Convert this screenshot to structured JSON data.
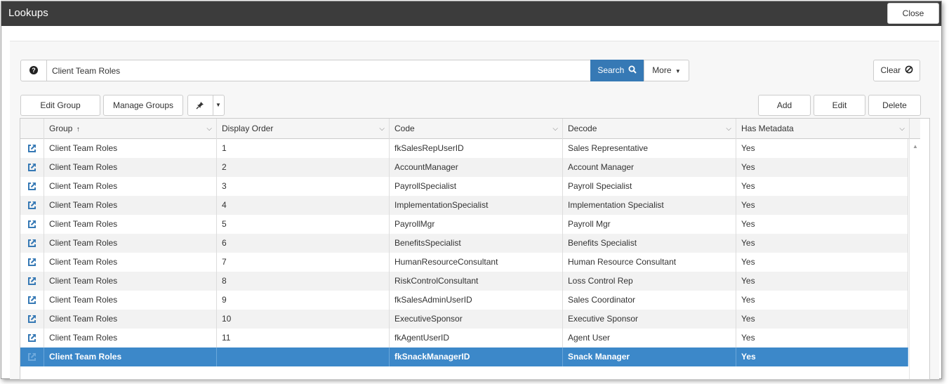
{
  "window": {
    "title": "Lookups",
    "close_label": "Close"
  },
  "search": {
    "help_symbol": "?",
    "value": "Client Team Roles",
    "search_label": "Search",
    "more_label": "More",
    "clear_label": "Clear"
  },
  "toolbar": {
    "edit_group": "Edit Group",
    "manage_groups": "Manage Groups",
    "add": "Add",
    "edit": "Edit",
    "delete": "Delete"
  },
  "grid": {
    "columns": [
      "Group",
      "Display Order",
      "Code",
      "Decode",
      "Has Metadata"
    ],
    "sort_indicator": "↑",
    "rows": [
      {
        "group": "Client Team Roles",
        "order": "1",
        "code": "fkSalesRepUserID",
        "decode": "Sales Representative",
        "meta": "Yes"
      },
      {
        "group": "Client Team Roles",
        "order": "2",
        "code": "AccountManager",
        "decode": "Account Manager",
        "meta": "Yes"
      },
      {
        "group": "Client Team Roles",
        "order": "3",
        "code": "PayrollSpecialist",
        "decode": "Payroll Specialist",
        "meta": "Yes"
      },
      {
        "group": "Client Team Roles",
        "order": "4",
        "code": "ImplementationSpecialist",
        "decode": "Implementation Specialist",
        "meta": "Yes"
      },
      {
        "group": "Client Team Roles",
        "order": "5",
        "code": "PayrollMgr",
        "decode": "Payroll Mgr",
        "meta": "Yes"
      },
      {
        "group": "Client Team Roles",
        "order": "6",
        "code": "BenefitsSpecialist",
        "decode": "Benefits Specialist",
        "meta": "Yes"
      },
      {
        "group": "Client Team Roles",
        "order": "7",
        "code": "HumanResourceConsultant",
        "decode": "Human Resource Consultant",
        "meta": "Yes"
      },
      {
        "group": "Client Team Roles",
        "order": "8",
        "code": "RiskControlConsultant",
        "decode": "Loss Control Rep",
        "meta": "Yes"
      },
      {
        "group": "Client Team Roles",
        "order": "9",
        "code": "fkSalesAdminUserID",
        "decode": "Sales Coordinator",
        "meta": "Yes"
      },
      {
        "group": "Client Team Roles",
        "order": "10",
        "code": "ExecutiveSponsor",
        "decode": "Executive Sponsor",
        "meta": "Yes"
      },
      {
        "group": "Client Team Roles",
        "order": "11",
        "code": "fkAgentUserID",
        "decode": "Agent User",
        "meta": "Yes"
      },
      {
        "group": "Client Team Roles",
        "order": "",
        "code": "fkSnackManagerID",
        "decode": "Snack Manager",
        "meta": "Yes",
        "selected": true
      }
    ]
  }
}
